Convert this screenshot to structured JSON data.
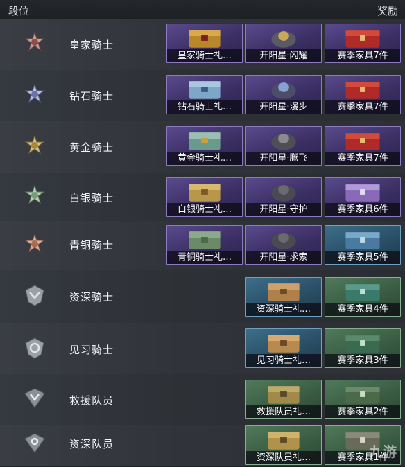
{
  "header": {
    "rank_label": "段位",
    "reward_label": "奖励"
  },
  "ranks": [
    {
      "name": "皇家骑士",
      "rewards": [
        "皇家骑士礼…",
        "开阳星·闪耀",
        "赛季家具7件"
      ]
    },
    {
      "name": "钻石骑士",
      "rewards": [
        "钻石骑士礼…",
        "开阳星·漫步",
        "赛季家具7件"
      ]
    },
    {
      "name": "黄金骑士",
      "rewards": [
        "黄金骑士礼…",
        "开阳星·腾飞",
        "赛季家具7件"
      ]
    },
    {
      "name": "白银骑士",
      "rewards": [
        "白银骑士礼…",
        "开阳星·守护",
        "赛季家具6件"
      ]
    },
    {
      "name": "青铜骑士",
      "rewards": [
        "青铜骑士礼…",
        "开阳星·求索",
        "赛季家具5件"
      ]
    },
    {
      "name": "资深骑士",
      "rewards": [
        "资深骑士礼…",
        "赛季家具4件"
      ]
    },
    {
      "name": "见习骑士",
      "rewards": [
        "见习骑士礼…",
        "赛季家具3件"
      ]
    },
    {
      "name": "救援队员",
      "rewards": [
        "救援队员礼…",
        "赛季家具2件"
      ]
    },
    {
      "name": "资深队员",
      "rewards": [
        "资深队员礼…",
        "赛季家具1件"
      ]
    }
  ],
  "watermark": "九游"
}
